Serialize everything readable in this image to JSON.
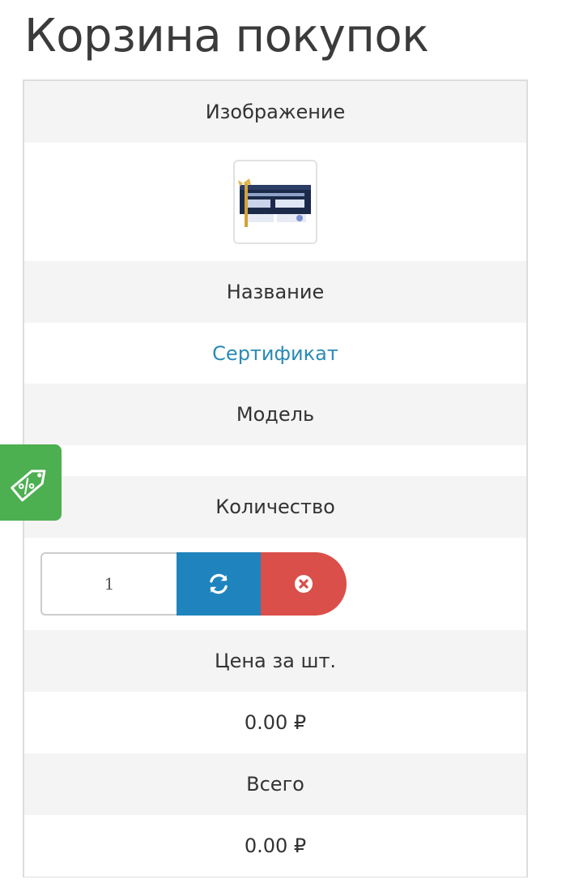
{
  "page": {
    "title": "Корзина покупок"
  },
  "cart": {
    "image_header": "Изображение",
    "name_header": "Название",
    "product_name": "Сертификат",
    "model_header": "Модель",
    "model_value": "",
    "quantity_header": "Количество",
    "quantity_value": "1",
    "price_header": "Цена за шт.",
    "price_value": "0.00 ₽",
    "total_header": "Всего",
    "total_value": "0.00 ₽"
  },
  "icons": {
    "refresh": "refresh-icon",
    "remove": "remove-circle-icon",
    "promo": "discount-tag-icon"
  },
  "colors": {
    "link": "#2a8bb5",
    "refresh_button": "#1f84bd",
    "remove_button": "#da4f49",
    "promo_tab": "#4caf50",
    "header_row_bg": "#f4f4f4"
  }
}
